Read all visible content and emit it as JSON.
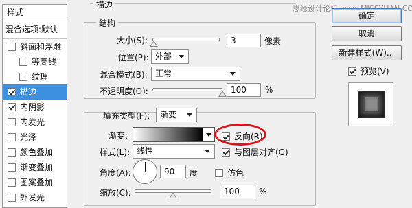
{
  "sidebar": {
    "header": "样式",
    "blend_options": "混合选项:默认",
    "items": [
      {
        "label": "斜面和浮雕",
        "checked": false,
        "indent": false,
        "selected": false
      },
      {
        "label": "等高线",
        "checked": false,
        "indent": true,
        "selected": false
      },
      {
        "label": "纹理",
        "checked": false,
        "indent": true,
        "selected": false
      },
      {
        "label": "描边",
        "checked": true,
        "indent": false,
        "selected": true
      },
      {
        "label": "内阴影",
        "checked": true,
        "indent": false,
        "selected": false
      },
      {
        "label": "内发光",
        "checked": false,
        "indent": false,
        "selected": false
      },
      {
        "label": "光泽",
        "checked": false,
        "indent": false,
        "selected": false
      },
      {
        "label": "颜色叠加",
        "checked": false,
        "indent": false,
        "selected": false
      },
      {
        "label": "渐变叠加",
        "checked": false,
        "indent": false,
        "selected": false
      },
      {
        "label": "图案叠加",
        "checked": false,
        "indent": false,
        "selected": false
      },
      {
        "label": "外发光",
        "checked": false,
        "indent": false,
        "selected": false
      }
    ]
  },
  "stroke": {
    "title": "描边",
    "structure_title": "结构",
    "size_label": "大小(S):",
    "size_value": "3",
    "size_unit": "像素",
    "size_slider_fraction": 0.02,
    "position_label": "位置(P):",
    "position_value": "外部",
    "blend_mode_label": "混合模式(B):",
    "blend_mode_value": "正常",
    "opacity_label": "不透明度(O):",
    "opacity_value": "100",
    "opacity_unit": "%",
    "opacity_slider_fraction": 1.0,
    "fill_type_label": "填充类型(F):",
    "fill_type_value": "渐变",
    "gradient_label": "渐变:",
    "reverse_label": "反向(R)",
    "reverse_checked": true,
    "style_label": "样式(L):",
    "style_value": "线性",
    "align_label": "与图层对齐(G)",
    "align_checked": true,
    "angle_label": "角度(A):",
    "angle_value": "90",
    "angle_unit": "度",
    "dither_label": "仿色",
    "dither_checked": false,
    "scale_label": "缩放(C):",
    "scale_value": "100",
    "scale_unit": "%",
    "scale_slider_fraction": 0.5
  },
  "buttons": {
    "ok": "确定",
    "cancel": "取消",
    "new_style": "新建样式(W)...",
    "preview_label": "预览(V)",
    "preview_checked": true
  },
  "watermark": "思缘设计论坛 www.MISSYUAN.COM",
  "colors": {
    "selection": "#3d8fe0",
    "highlight_ring": "#d9141c"
  }
}
